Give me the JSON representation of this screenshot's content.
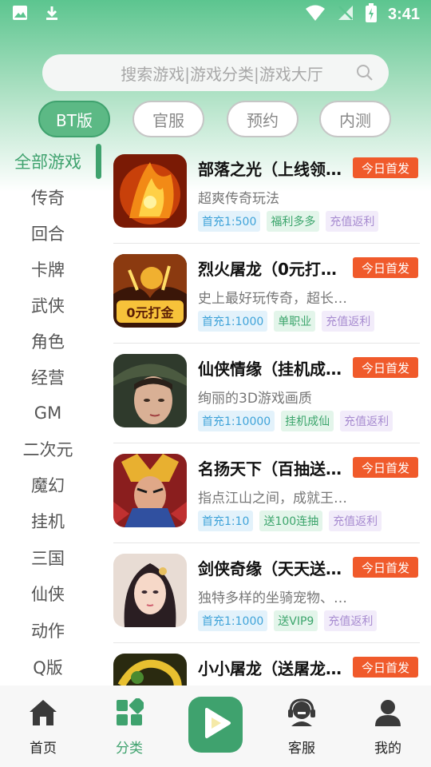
{
  "status_bar": {
    "time": "3:41"
  },
  "search": {
    "placeholder": "搜索游戏|游戏分类|游戏大厅"
  },
  "type_tabs": [
    {
      "label": "BT版",
      "active": true
    },
    {
      "label": "官服",
      "active": false
    },
    {
      "label": "预约",
      "active": false
    },
    {
      "label": "内测",
      "active": false
    }
  ],
  "categories": [
    {
      "label": "全部游戏",
      "active": true
    },
    {
      "label": "传奇"
    },
    {
      "label": "回合"
    },
    {
      "label": "卡牌"
    },
    {
      "label": "武侠"
    },
    {
      "label": "角色"
    },
    {
      "label": "经营"
    },
    {
      "label": "GM"
    },
    {
      "label": "二次元"
    },
    {
      "label": "魔幻"
    },
    {
      "label": "挂机"
    },
    {
      "label": "三国"
    },
    {
      "label": "仙侠"
    },
    {
      "label": "动作"
    },
    {
      "label": "Q版"
    }
  ],
  "games": [
    {
      "title": "部落之光（上线领…",
      "desc": "超爽传奇玩法",
      "badge": "今日首发",
      "tags": [
        "首充1:500",
        "福利多多",
        "充值返利"
      ],
      "icon": "fire-game-icon"
    },
    {
      "title": "烈火屠龙（0元打…",
      "desc": "史上最好玩传奇，超长…",
      "badge": "今日首发",
      "tags": [
        "首充1:1000",
        "单职业",
        "充值返利"
      ],
      "icon": "dragon-game-icon",
      "icon_text": "0元打金"
    },
    {
      "title": "仙侠情缘（挂机成…",
      "desc": "绚丽的3D游戏画质",
      "badge": "今日首发",
      "tags": [
        "首充1:10000",
        "挂机成仙",
        "充值返利"
      ],
      "icon": "warrior-game-icon"
    },
    {
      "title": "名扬天下（百抽送…",
      "desc": "指点江山之间，成就王…",
      "badge": "今日首发",
      "tags": [
        "首充1:10",
        "送100连抽",
        "充值返利"
      ],
      "icon": "general-game-icon"
    },
    {
      "title": "剑侠奇缘（天天送…",
      "desc": "独特多样的坐骑宠物、…",
      "badge": "今日首发",
      "tags": [
        "首充1:1000",
        "送VIP9",
        "充值返利"
      ],
      "icon": "heroine-game-icon"
    },
    {
      "title": "小小屠龙（送屠龙…",
      "desc": "",
      "badge": "今日首发",
      "tags": [],
      "icon": "small-dragon-game-icon"
    }
  ],
  "bottom_nav": [
    {
      "label": "首页",
      "icon": "home-icon"
    },
    {
      "label": "分类",
      "icon": "category-icon",
      "active": true
    },
    {
      "label": "",
      "icon": "play-icon"
    },
    {
      "label": "客服",
      "icon": "headset-icon"
    },
    {
      "label": "我的",
      "icon": "user-icon"
    }
  ]
}
